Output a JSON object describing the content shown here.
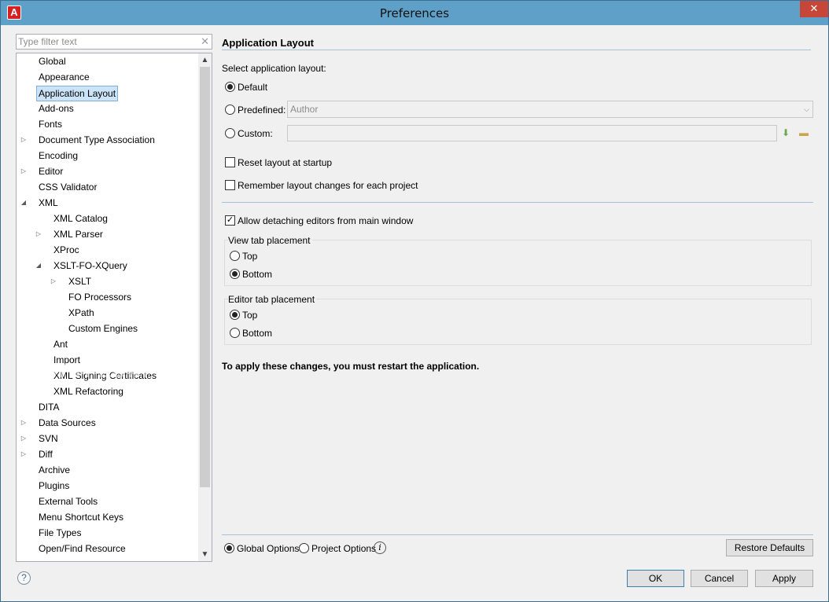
{
  "window": {
    "title": "Preferences",
    "close_glyph": "✕",
    "app_icon": "A"
  },
  "filter": {
    "placeholder": "Type filter text",
    "clear_glyph": "✕"
  },
  "tree": [
    {
      "label": "Global",
      "level": 0,
      "expander": ""
    },
    {
      "label": "Appearance",
      "level": 0,
      "expander": ""
    },
    {
      "label": "Application Layout",
      "level": 0,
      "expander": "",
      "selected": true
    },
    {
      "label": "Add-ons",
      "level": 0,
      "expander": ""
    },
    {
      "label": "Fonts",
      "level": 0,
      "expander": ""
    },
    {
      "label": "Document Type Association",
      "level": 0,
      "expander": "collapsed"
    },
    {
      "label": "Encoding",
      "level": 0,
      "expander": ""
    },
    {
      "label": "Editor",
      "level": 0,
      "expander": "collapsed"
    },
    {
      "label": "CSS Validator",
      "level": 0,
      "expander": ""
    },
    {
      "label": "XML",
      "level": 0,
      "expander": "expanded"
    },
    {
      "label": "XML Catalog",
      "level": 1,
      "expander": ""
    },
    {
      "label": "XML Parser",
      "level": 1,
      "expander": "collapsed"
    },
    {
      "label": "XProc",
      "level": 1,
      "expander": ""
    },
    {
      "label": "XSLT-FO-XQuery",
      "level": 1,
      "expander": "expanded"
    },
    {
      "label": "XSLT",
      "level": 2,
      "expander": "collapsed"
    },
    {
      "label": "FO Processors",
      "level": 2,
      "expander": ""
    },
    {
      "label": "XPath",
      "level": 2,
      "expander": ""
    },
    {
      "label": "Custom Engines",
      "level": 2,
      "expander": ""
    },
    {
      "label": "Ant",
      "level": 1,
      "expander": ""
    },
    {
      "label": "Import",
      "level": 1,
      "expander": ""
    },
    {
      "label": "XML Signing Certificates",
      "level": 1,
      "expander": ""
    },
    {
      "label": "XML Refactoring",
      "level": 1,
      "expander": ""
    },
    {
      "label": "DITA",
      "level": 0,
      "expander": ""
    },
    {
      "label": "Data Sources",
      "level": 0,
      "expander": "collapsed"
    },
    {
      "label": "SVN",
      "level": 0,
      "expander": "collapsed"
    },
    {
      "label": "Diff",
      "level": 0,
      "expander": "collapsed"
    },
    {
      "label": "Archive",
      "level": 0,
      "expander": ""
    },
    {
      "label": "Plugins",
      "level": 0,
      "expander": ""
    },
    {
      "label": "External Tools",
      "level": 0,
      "expander": ""
    },
    {
      "label": "Menu Shortcut Keys",
      "level": 0,
      "expander": ""
    },
    {
      "label": "File Types",
      "level": 0,
      "expander": ""
    },
    {
      "label": "Open/Find Resource",
      "level": 0,
      "expander": ""
    }
  ],
  "panel": {
    "title": "Application Layout",
    "select_label": "Select application layout:",
    "layout_options": {
      "default": {
        "label": "Default",
        "checked": true
      },
      "predefined": {
        "label": "Predefined:",
        "checked": false,
        "value": "Author"
      },
      "custom": {
        "label": "Custom:",
        "checked": false,
        "value": ""
      }
    },
    "reset_layout": {
      "label": "Reset layout at startup",
      "checked": false
    },
    "remember_layout": {
      "label": "Remember layout changes for each project",
      "checked": false
    },
    "allow_detaching": {
      "label": "Allow detaching editors from main window",
      "checked": true
    },
    "view_tab": {
      "title": "View tab placement",
      "top": "Top",
      "bottom": "Bottom",
      "selected": "Bottom"
    },
    "editor_tab": {
      "title": "Editor tab placement",
      "top": "Top",
      "bottom": "Bottom",
      "selected": "Top"
    },
    "note": "To apply these changes, you must restart the application."
  },
  "scope": {
    "global": "Global Options",
    "project": "Project Options",
    "selected": "Global Options",
    "info_glyph": "i"
  },
  "buttons": {
    "restore": "Restore Defaults",
    "ok": "OK",
    "cancel": "Cancel",
    "apply": "Apply"
  },
  "help_glyph": "?",
  "watermark": "SOFTPEDIA"
}
